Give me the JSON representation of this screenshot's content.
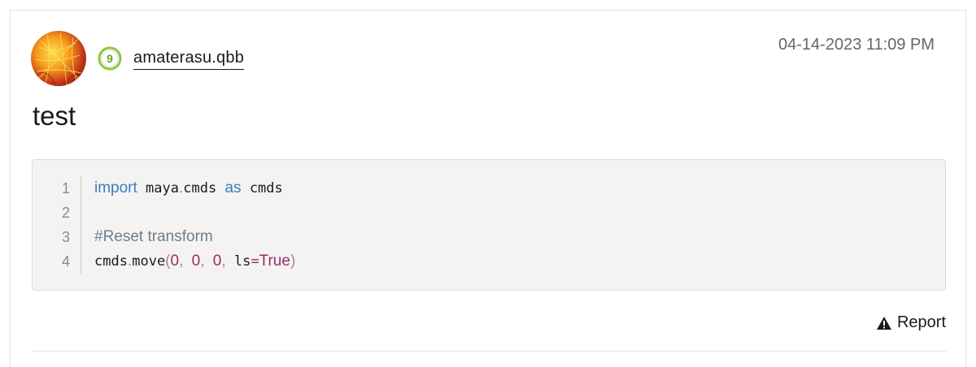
{
  "post": {
    "username": "amaterasu.qbb",
    "rank_badge": "9",
    "timestamp": "04-14-2023 11:09 PM",
    "title": "test",
    "report_label": "Report"
  },
  "code": {
    "line_numbers": [
      "1",
      "2",
      "3",
      "4"
    ],
    "line1": {
      "kw1": "import",
      "mod1": "maya",
      "dot": ".",
      "mod2": "cmds",
      "kw2": "as",
      "alias": "cmds"
    },
    "line3": {
      "comment": "#Reset transform"
    },
    "line4": {
      "obj": "cmds",
      "dot": ".",
      "func": "move",
      "lparen": "(",
      "a1": "0",
      "c1": ",",
      "a2": "0",
      "c2": ",",
      "a3": "0",
      "c3": ",",
      "kw": "ls",
      "eq": "=",
      "val": "True",
      "rparen": ")"
    }
  },
  "colors": {
    "keyword": "#3b7dc4",
    "comment": "#6e7e8e",
    "number": "#9a2a6a",
    "code_bg": "#f5f3f1",
    "badge": "#8dc63f"
  },
  "icons": [
    "avatar-image",
    "rank-badge-icon",
    "warning-icon"
  ]
}
